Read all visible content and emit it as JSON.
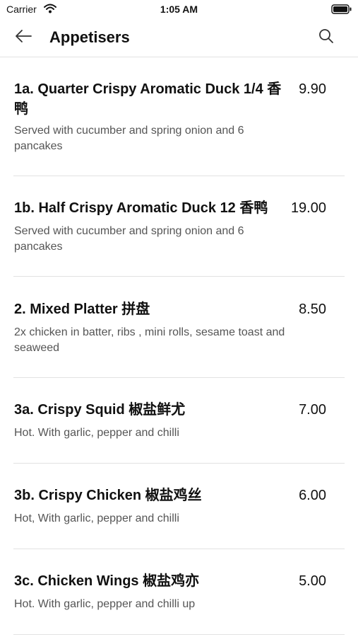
{
  "status_bar": {
    "carrier": "Carrier",
    "time": "1:05 AM"
  },
  "header": {
    "title": "Appetisers"
  },
  "icons": {
    "back": "back-arrow-icon",
    "search": "search-icon",
    "wifi": "wifi-icon",
    "battery": "battery-icon"
  },
  "items": [
    {
      "name": "1a. Quarter Crispy Aromatic Duck 1/4 香鸭",
      "price": "9.90",
      "description": "Served with cucumber and spring onion and 6 pancakes"
    },
    {
      "name": "1b. Half Crispy Aromatic Duck 12 香鸭",
      "price": "19.00",
      "description": "Served with cucumber and spring onion and 6 pancakes"
    },
    {
      "name": "2. Mixed Platter 拼盘",
      "price": "8.50",
      "description": "2x chicken in batter, ribs , mini rolls, sesame toast and seaweed"
    },
    {
      "name": "3a. Crispy Squid 椒盐鲜尤",
      "price": "7.00",
      "description": "Hot. With garlic, pepper and chilli"
    },
    {
      "name": "3b. Crispy Chicken 椒盐鸡丝",
      "price": "6.00",
      "description": "Hot, With garlic, pepper and chilli"
    },
    {
      "name": "3c. Chicken Wings 椒盐鸡亦",
      "price": "5.00",
      "description": "Hot. With garlic, pepper and chilli up"
    }
  ]
}
